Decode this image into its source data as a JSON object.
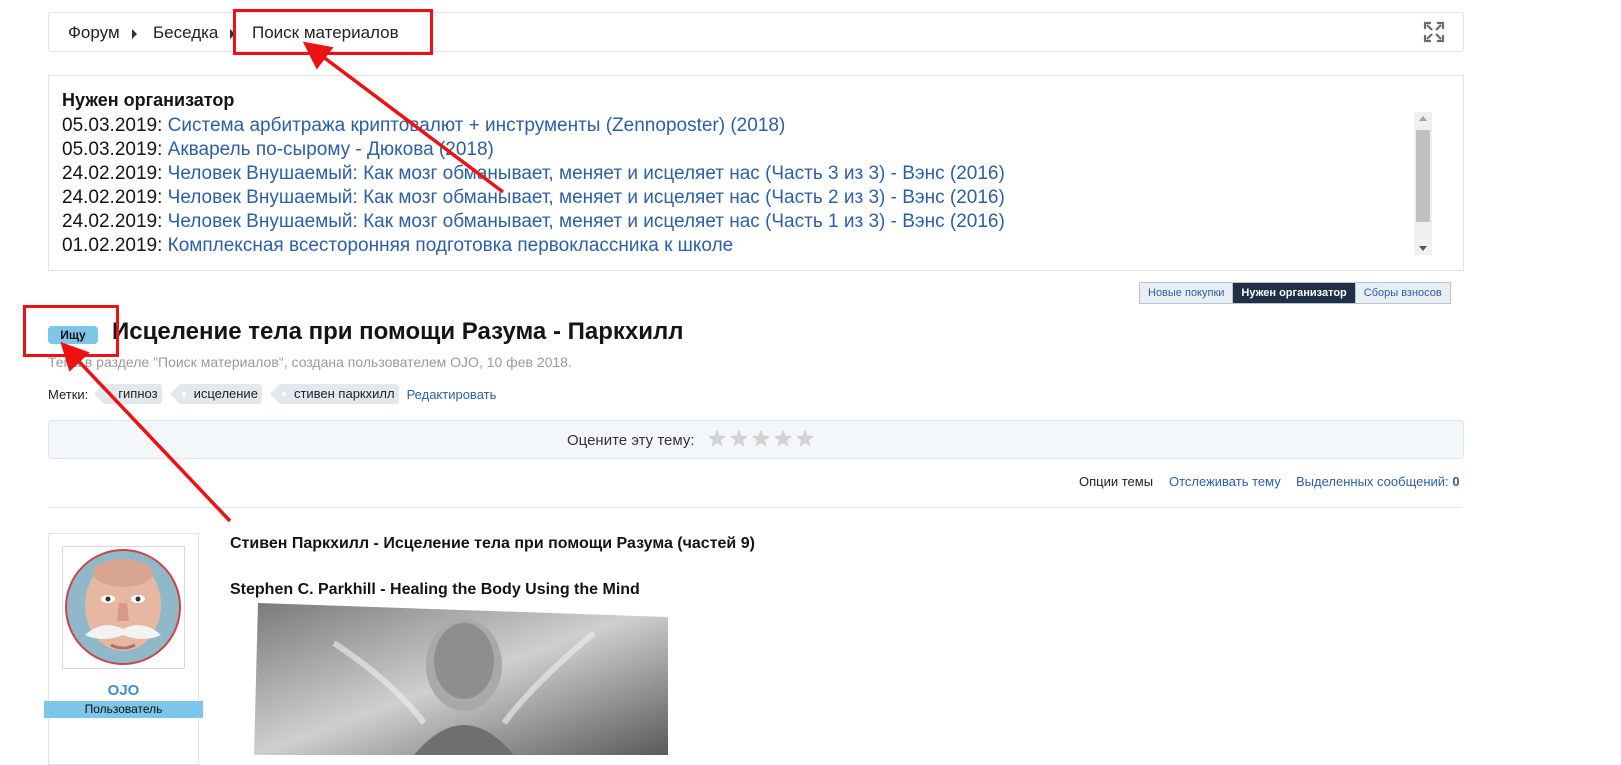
{
  "breadcrumb": {
    "items": [
      "Форум",
      "Беседка",
      "Поиск материалов"
    ]
  },
  "ticker": {
    "title": "Нужен организатор",
    "entries": [
      {
        "date": "05.03.2019",
        "link": "Система арбитража криптовалют + инструменты (Zennoposter) (2018)"
      },
      {
        "date": "05.03.2019",
        "link": "Акварель по-сырому - Дюкова (2018)"
      },
      {
        "date": "24.02.2019",
        "link": "Человек Внушаемый: Как мозг обманывает, меняет и исцеляет нас (Часть 3 из 3) - Вэнс (2016)"
      },
      {
        "date": "24.02.2019",
        "link": "Человек Внушаемый: Как мозг обманывает, меняет и исцеляет нас (Часть 2 из 3) - Вэнс (2016)"
      },
      {
        "date": "24.02.2019",
        "link": "Человек Внушаемый: Как мозг обманывает, меняет и исцеляет нас (Часть 1 из 3) - Вэнс (2016)"
      },
      {
        "date": "01.02.2019",
        "link": "Комплексная всесторонняя подготовка первоклассника к школе"
      }
    ]
  },
  "tabs": [
    {
      "label": "Новые покупки",
      "active": false
    },
    {
      "label": "Нужен организатор",
      "active": true
    },
    {
      "label": "Сборы взносов",
      "active": false
    }
  ],
  "thread": {
    "prefix": "Ищу",
    "title": "Исцеление тела при помощи Разума - Паркхилл",
    "meta": "Тема в разделе \"Поиск материалов\", создана пользователем OJO, 10 фев 2018.",
    "tags_label": "Метки:",
    "tags": [
      "гипноз",
      "исцеление",
      "стивен паркхилл"
    ],
    "edit_label": "Редактировать",
    "rating_label": "Оцените эту тему:",
    "stars": 5
  },
  "options": {
    "thread_options": "Опции темы",
    "watch": "Отслеживать тему",
    "selected_label": "Выделенных сообщений:",
    "selected_count": "0"
  },
  "post": {
    "username": "OJO",
    "user_title": "Пользователь",
    "heading1": "Стивен Паркхилл - Исцеление тела при помощи Разума (частей 9)",
    "heading2": "Stephen C. Parkhill - Healing the Body Using the Mind"
  },
  "colors": {
    "link": "#2b5fa8",
    "accent_blue": "#7ec5ea",
    "active_tab": "#1f2f44",
    "annotation_red": "#ee1111"
  },
  "icons": [
    "expand-icon",
    "chevron-right-icon",
    "star-icon",
    "scroll-up-icon",
    "scroll-down-icon"
  ]
}
